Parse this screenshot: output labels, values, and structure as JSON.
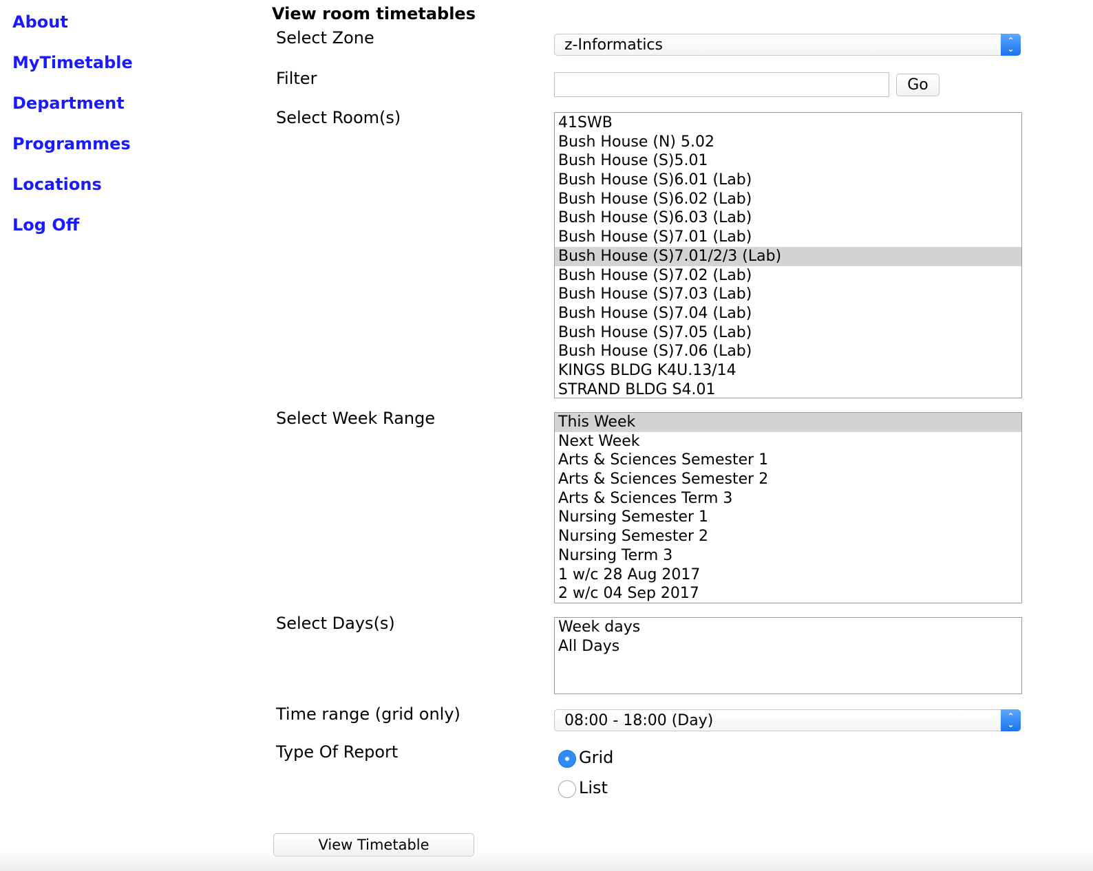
{
  "nav": {
    "items": [
      {
        "label": "About"
      },
      {
        "label": "MyTimetable"
      },
      {
        "label": "Department"
      },
      {
        "label": "Programmes"
      },
      {
        "label": "Locations"
      },
      {
        "label": "Log Off"
      }
    ]
  },
  "page_title": "View room timetables",
  "form": {
    "zone": {
      "label": "Select Zone",
      "value": "z-Informatics"
    },
    "filter": {
      "label": "Filter",
      "value": "",
      "go_label": "Go"
    },
    "rooms": {
      "label": "Select Room(s)",
      "options": [
        "41SWB",
        "Bush House (N) 5.02",
        "Bush House (S)5.01",
        "Bush House (S)6.01 (Lab)",
        "Bush House (S)6.02 (Lab)",
        "Bush House (S)6.03 (Lab)",
        "Bush House (S)7.01 (Lab)",
        "Bush House (S)7.01/2/3 (Lab)",
        "Bush House (S)7.02 (Lab)",
        "Bush House (S)7.03 (Lab)",
        "Bush House (S)7.04 (Lab)",
        "Bush House (S)7.05 (Lab)",
        "Bush House (S)7.06 (Lab)",
        "KINGS BLDG K4U.13/14",
        "STRAND BLDG S4.01"
      ],
      "selected": "Bush House (S)7.01/2/3 (Lab)"
    },
    "weeks": {
      "label": "Select Week Range",
      "options": [
        "This Week",
        "Next Week",
        "Arts & Sciences Semester 1",
        "Arts & Sciences Semester 2",
        "Arts & Sciences Term 3",
        "Nursing Semester 1",
        "Nursing Semester 2",
        "Nursing Term 3",
        "1 w/c 28 Aug 2017",
        "2 w/c 04 Sep 2017"
      ],
      "selected": "This Week"
    },
    "days": {
      "label": "Select Days(s)",
      "options": [
        "Week days",
        "All Days"
      ]
    },
    "time_range": {
      "label": "Time range (grid only)",
      "value": "08:00 - 18:00 (Day)"
    },
    "report_type": {
      "label": "Type Of Report",
      "options": [
        {
          "label": "Grid",
          "checked": true
        },
        {
          "label": "List",
          "checked": false
        }
      ]
    },
    "submit_label": "View Timetable"
  }
}
